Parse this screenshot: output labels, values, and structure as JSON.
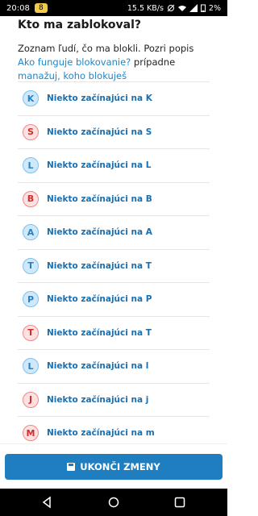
{
  "status_bar": {
    "time": "20:08",
    "notif_badge": "8",
    "right_text": "15.5 KB/s",
    "battery": "2%"
  },
  "page": {
    "title": "Kto ma zablokoval?",
    "desc_plain_1": "Zoznam ľudí, čo ma blokli. Pozri popis ",
    "desc_link_1": "Ako funguje blokovanie?",
    "desc_plain_2": " prípadne ",
    "desc_link_2": "manažuj, koho blokuješ"
  },
  "blocked_list": [
    {
      "initial": "K",
      "label": "Niekto začínajúci na K",
      "color": "blue"
    },
    {
      "initial": "S",
      "label": "Niekto začínajúci na S",
      "color": "red"
    },
    {
      "initial": "L",
      "label": "Niekto začínajúci na L",
      "color": "blue"
    },
    {
      "initial": "B",
      "label": "Niekto začínajúci na B",
      "color": "red"
    },
    {
      "initial": "A",
      "label": "Niekto začínajúci na A",
      "color": "blue"
    },
    {
      "initial": "T",
      "label": "Niekto začínajúci na T",
      "color": "blue"
    },
    {
      "initial": "P",
      "label": "Niekto začínajúci na P",
      "color": "blue"
    },
    {
      "initial": "T",
      "label": "Niekto začínajúci na T",
      "color": "red"
    },
    {
      "initial": "L",
      "label": "Niekto začínajúci na l",
      "color": "blue"
    },
    {
      "initial": "J",
      "label": "Niekto začínajúci na j",
      "color": "red"
    },
    {
      "initial": "M",
      "label": "Niekto začínajúci na m",
      "color": "red"
    }
  ],
  "footer": {
    "save_label": "UKONČI ZMENY",
    "save_icon": "save-icon"
  },
  "colors": {
    "accent": "#1f7ec0",
    "blue_avatar": "#cfe9fb",
    "red_avatar": "#fde1e1"
  }
}
